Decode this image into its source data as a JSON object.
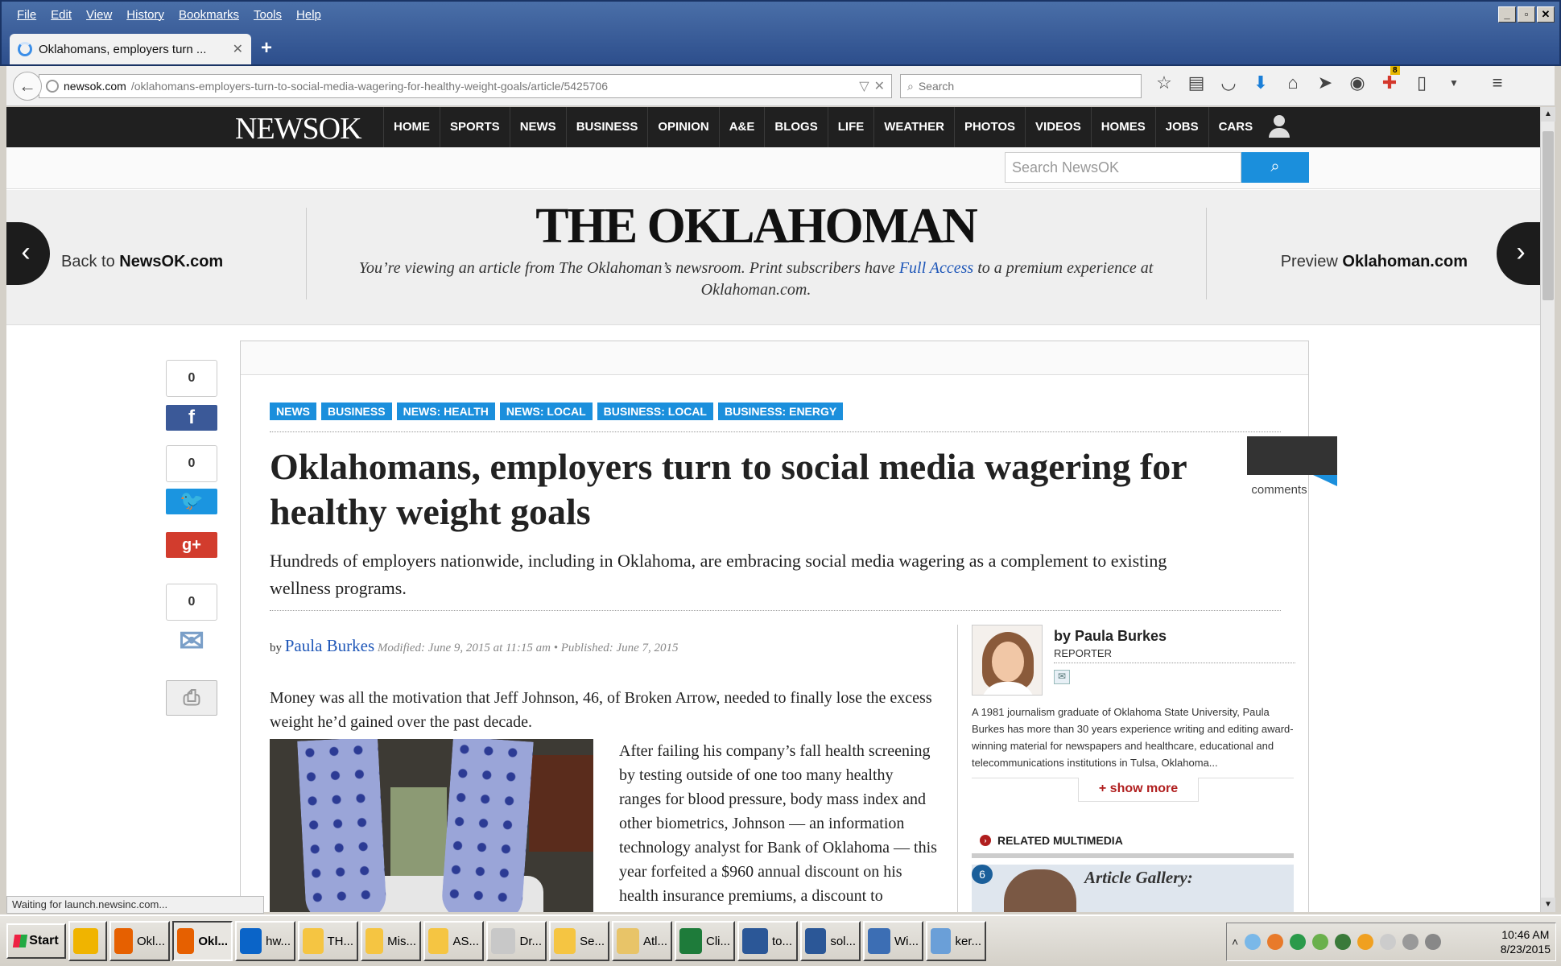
{
  "browser": {
    "menu": [
      "File",
      "Edit",
      "View",
      "History",
      "Bookmarks",
      "Tools",
      "Help"
    ],
    "window_controls": [
      "_",
      "▫",
      "✕"
    ],
    "tab_title": "Oklahomans, employers turn ...",
    "tab_close": "✕",
    "new_tab": "+",
    "url_domain": "newsok.com",
    "url_path": "/oklahomans-employers-turn-to-social-media-wagering-for-healthy-weight-goals/article/5425706",
    "search_placeholder": "Search",
    "toolbar_icons": [
      "star-icon",
      "clipboard-icon",
      "pocket-icon",
      "download-icon",
      "home-icon",
      "send-icon",
      "chat-icon",
      "puzzle-icon",
      "document-icon",
      "menu-icon"
    ],
    "addon_badge": "8",
    "status": "Waiting for launch.newsinc.com..."
  },
  "site": {
    "logo": "NEWSOK",
    "nav": [
      "HOME",
      "SPORTS",
      "NEWS",
      "BUSINESS",
      "OPINION",
      "A&E",
      "BLOGS",
      "LIFE",
      "WEATHER",
      "PHOTOS",
      "VIDEOS",
      "HOMES",
      "JOBS",
      "CARS"
    ],
    "search_placeholder": "Search NewsOK",
    "back_label": "Back to ",
    "back_bold": "NewsOK.com",
    "preview_label": "Preview ",
    "preview_bold": "Oklahoman.com",
    "masthead": "THE OKLAHOMAN",
    "note_pre": "You’re viewing an article from The Oklahoman’s newsroom. Print subscribers have ",
    "note_link": "Full Access",
    "note_post": " to a premium experience at Oklahoman.com."
  },
  "article": {
    "tags": [
      "NEWS",
      "BUSINESS",
      "NEWS: HEALTH",
      "NEWS: LOCAL",
      "BUSINESS: LOCAL",
      "BUSINESS: ENERGY"
    ],
    "headline": "Oklahomans, employers turn to social media wagering for healthy weight goals",
    "dek": "Hundreds of employers nationwide, including in Oklahoma, are embracing social media wagering as a complement to existing wellness programs.",
    "comments_label": "comments",
    "by": "by",
    "author": "Paula Burkes",
    "dates": "Modified: June 9, 2015 at 11:15 am • Published: June 7, 2015",
    "para1": "Money was all the motivation that Jeff Johnson, 46, of Broken Arrow, needed to finally lose the excess weight he’d gained over the past decade.",
    "para2": "After failing his company’s fall health screening by testing outside of one too many healthy ranges for blood pressure, body mass index and other biometrics, Johnson — an information technology analyst for Bank of Oklahoma — this year forfeited a $960 annual discount on his health insurance premiums, a discount to"
  },
  "share": {
    "facebook_count": "0",
    "twitter_count": "0",
    "email_count": "0",
    "facebook_glyph": "f",
    "gplus_glyph": "g+"
  },
  "author_box": {
    "name": "by Paula Burkes",
    "role": "REPORTER",
    "bio": "A 1981 journalism graduate of Oklahoma State University, Paula Burkes has more than 30 years experience writing and editing award-winning material for newspapers and healthcare, educational and telecommunications institutions in Tulsa, Oklahoma...",
    "show_more": "+ show more",
    "related_heading": "RELATED MULTIMEDIA",
    "gallery_count": "6",
    "gallery_title": "Article Gallery:"
  },
  "taskbar": {
    "start": "Start",
    "items": [
      {
        "label": "",
        "color": "#f0b400"
      },
      {
        "label": "Okl...",
        "color": "#e66000"
      },
      {
        "label": "Okl...",
        "color": "#e66000",
        "active": true
      },
      {
        "label": "hw...",
        "color": "#0a64c8"
      },
      {
        "label": "TH...",
        "color": "#f5c542"
      },
      {
        "label": "Mis...",
        "color": "#f5c542"
      },
      {
        "label": "AS...",
        "color": "#f5c542"
      },
      {
        "label": "Dr...",
        "color": "#c8c8c8"
      },
      {
        "label": "Se...",
        "color": "#f5c542"
      },
      {
        "label": "Atl...",
        "color": "#e8c468"
      },
      {
        "label": "Cli...",
        "color": "#1e7b3a"
      },
      {
        "label": "to...",
        "color": "#2b5797"
      },
      {
        "label": "sol...",
        "color": "#2b5797"
      },
      {
        "label": "Wi...",
        "color": "#3c6eb4"
      },
      {
        "label": "ker...",
        "color": "#6a9fd8"
      }
    ],
    "time": "10:46 AM",
    "date": "8/23/2015"
  }
}
